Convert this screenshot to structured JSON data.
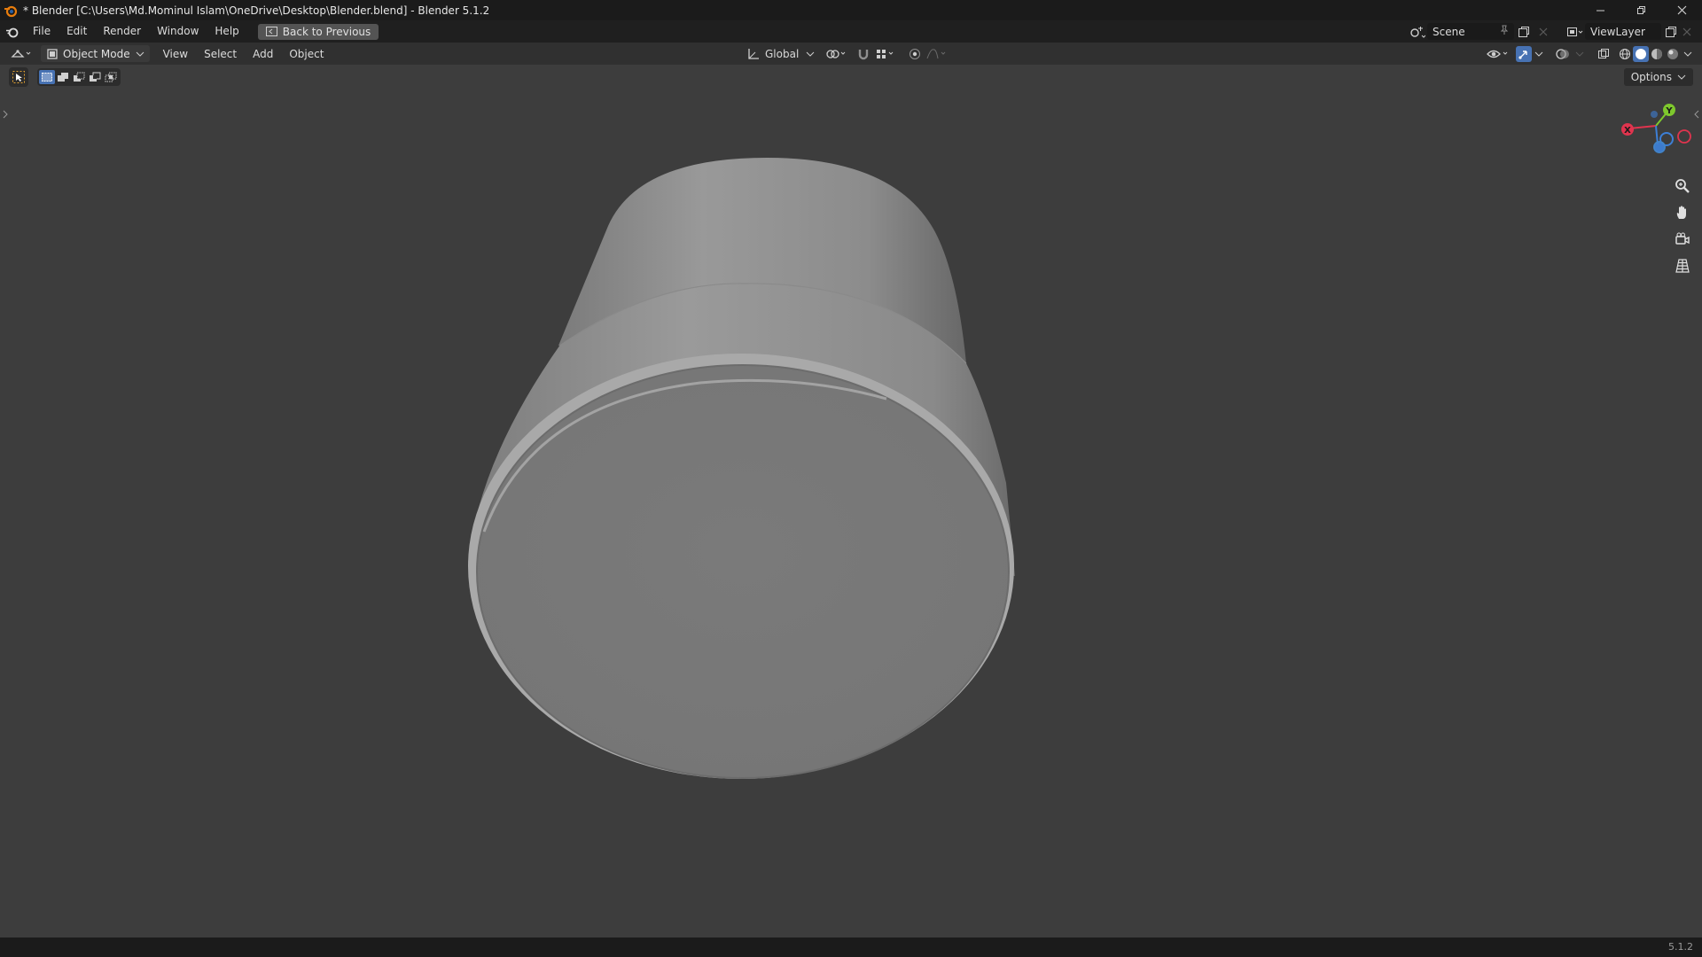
{
  "window": {
    "title": "* Blender [C:\\Users\\Md.Mominul Islam\\OneDrive\\Desktop\\Blender.blend] - Blender 5.1.2",
    "controls": [
      "minimize-icon",
      "restore-icon",
      "close-icon"
    ]
  },
  "menubar": {
    "items": [
      "File",
      "Edit",
      "Render",
      "Window",
      "Help"
    ],
    "back_button": "Back to Previous",
    "scene": "Scene",
    "view_layer": "ViewLayer"
  },
  "viewport_header": {
    "mode": "Object Mode",
    "menus": [
      "View",
      "Select",
      "Add",
      "Object"
    ],
    "transform_orientation": "Global",
    "shading_active": "solid"
  },
  "tool_settings": {
    "options_label": "Options"
  },
  "gizmo": {
    "axes": [
      "X",
      "Y",
      "Z"
    ],
    "colors": {
      "x": "#e0344e",
      "y": "#7ec82d",
      "z": "#3d7fd6"
    }
  },
  "navigation": [
    "zoom-icon",
    "hand-pan-icon",
    "camera-icon",
    "grid-perspective-icon"
  ],
  "statusbar": {
    "version": "5.1.2"
  },
  "colors": {
    "viewport_bg": "#3d3d3d",
    "accent": "#4772b3",
    "title_bar": "#1b1b1b"
  }
}
